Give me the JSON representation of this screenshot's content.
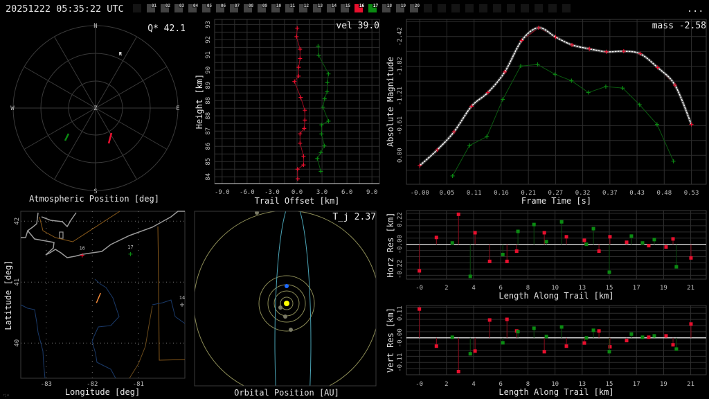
{
  "header": {
    "timestamp": "20251222 05:35:22 UTC",
    "menu_label": "...",
    "camera_boxes": [
      {
        "label": "",
        "state": "inactive"
      },
      {
        "label": "01",
        "state": "off"
      },
      {
        "label": "02",
        "state": "off"
      },
      {
        "label": "03",
        "state": "off"
      },
      {
        "label": "04",
        "state": "off"
      },
      {
        "label": "05",
        "state": "off"
      },
      {
        "label": "06",
        "state": "off"
      },
      {
        "label": "07",
        "state": "off"
      },
      {
        "label": "08",
        "state": "off"
      },
      {
        "label": "09",
        "state": "off"
      },
      {
        "label": "10",
        "state": "off"
      },
      {
        "label": "11",
        "state": "off"
      },
      {
        "label": "12",
        "state": "off"
      },
      {
        "label": "13",
        "state": "off"
      },
      {
        "label": "14",
        "state": "off"
      },
      {
        "label": "15",
        "state": "off"
      },
      {
        "label": "16",
        "state": "red"
      },
      {
        "label": "17",
        "state": "green"
      },
      {
        "label": "18",
        "state": "off"
      },
      {
        "label": "19",
        "state": "off"
      },
      {
        "label": "20",
        "state": "off"
      },
      {
        "label": "",
        "state": "inactive"
      },
      {
        "label": "",
        "state": "inactive"
      },
      {
        "label": "",
        "state": "inactive"
      },
      {
        "label": "",
        "state": "inactive"
      },
      {
        "label": "",
        "state": "inactive"
      },
      {
        "label": "",
        "state": "inactive"
      },
      {
        "label": "",
        "state": "inactive"
      },
      {
        "label": "",
        "state": "inactive"
      },
      {
        "label": "",
        "state": "inactive"
      },
      {
        "label": "",
        "state": "inactive"
      },
      {
        "label": "",
        "state": "inactive"
      }
    ]
  },
  "colors": {
    "red": "#e8102e",
    "green": "#0b8a12",
    "off": "#424242",
    "inactive": "#141414",
    "fit": "#ffffff",
    "trail": "#f28a3a",
    "orbit": "#8a8a55",
    "comet": "#4aa3b5",
    "earth": "#1f6bff",
    "sun": "#ffff00"
  },
  "atmospheric": {
    "title": "Atmospheric Position [deg]",
    "stat": "Q* 42.1",
    "labels": {
      "n": "N",
      "e": "E",
      "s": "S",
      "w": "W",
      "zenith": "Z",
      "radiant": "R"
    }
  },
  "map": {
    "xlabel": "Longitude [deg]",
    "ylabel": "Latitude [deg]",
    "x_ticks": [
      {
        "v": -83,
        "label": "-83"
      },
      {
        "v": -82,
        "label": "-82"
      },
      {
        "v": -81,
        "label": "-81"
      }
    ],
    "y_ticks": [
      {
        "v": 42,
        "label": "42"
      },
      {
        "v": 41,
        "label": "41"
      },
      {
        "v": 40,
        "label": "40"
      }
    ],
    "stations": [
      {
        "id": "16",
        "lon": -82.22,
        "lat": 41.44,
        "color": "red"
      },
      {
        "id": "17",
        "lon": -81.17,
        "lat": 41.46,
        "color": "green"
      },
      {
        "id": "14",
        "lon": -80.05,
        "lat": 40.63,
        "color": "off"
      }
    ],
    "trail": {
      "start": [
        -81.82,
        40.82
      ],
      "end": [
        -81.91,
        40.66
      ]
    },
    "watermark": "rjw"
  },
  "orbit": {
    "title": "Orbital Position [AU]",
    "stat": "T_j 2.37"
  },
  "chart_data": [
    {
      "type": "line",
      "id": "height",
      "title": "",
      "stat": "vel 39.0",
      "xlabel": "Trail Offset [km]",
      "ylabel": "Height [km]",
      "xlim": [
        -9.9,
        9.9
      ],
      "ylim": [
        83.6,
        93.3
      ],
      "x_ticks": [
        {
          "v": -9,
          "label": "-9.0"
        },
        {
          "v": -6,
          "label": "-6.0"
        },
        {
          "v": -3,
          "label": "-3.0"
        },
        {
          "v": 0,
          "label": "0.0"
        },
        {
          "v": 3,
          "label": "3.0"
        },
        {
          "v": 6,
          "label": "6.0"
        },
        {
          "v": 9,
          "label": "9.0"
        }
      ],
      "y_ticks": [
        {
          "v": 93.0,
          "label": "93"
        },
        {
          "v": 92.1,
          "label": "92"
        },
        {
          "v": 91.2,
          "label": "91"
        },
        {
          "v": 90.3,
          "label": "90"
        },
        {
          "v": 89.4,
          "label": "89"
        },
        {
          "v": 88.5,
          "label": "88"
        },
        {
          "v": 87.6,
          "label": "88"
        },
        {
          "v": 86.7,
          "label": "87"
        },
        {
          "v": 85.8,
          "label": "86"
        },
        {
          "v": 84.9,
          "label": "85"
        },
        {
          "v": 84.0,
          "label": "84"
        }
      ],
      "series": [
        {
          "name": "16",
          "color": "red",
          "x": [
            0.02,
            -0.06,
            0.36,
            0.36,
            0.19,
            0.19,
            -0.31,
            0.44,
            0.94,
            0.94,
            0.86,
            0.36,
            0.36,
            0.78,
            0.78,
            0.06,
            0.08
          ],
          "y": [
            92.78,
            92.28,
            91.54,
            90.99,
            90.47,
            89.95,
            89.63,
            88.69,
            87.93,
            87.35,
            86.86,
            86.54,
            85.99,
            85.22,
            84.7,
            84.45,
            83.88
          ]
        },
        {
          "name": "17",
          "color": "green",
          "x": [
            2.53,
            2.61,
            3.78,
            3.64,
            3.61,
            3.31,
            3.11,
            3.78,
            2.94,
            2.94,
            3.28,
            2.86,
            2.44,
            2.86
          ],
          "y": [
            91.72,
            91.17,
            90.08,
            89.57,
            89.03,
            88.61,
            88.11,
            87.29,
            87.07,
            86.53,
            85.83,
            85.43,
            85.08,
            84.32
          ]
        }
      ]
    },
    {
      "type": "line",
      "id": "magnitude",
      "stat": "mass -2.58",
      "xlabel": "Frame Time [s]",
      "ylabel": "Absolute Magnitude",
      "xlim": [
        -0.026,
        0.559
      ],
      "ylim": [
        0.59,
        -2.77
      ],
      "x_ticks": [
        {
          "v": 0,
          "label": "-0.00"
        },
        {
          "v": 0.053,
          "label": "0.05"
        },
        {
          "v": 0.106,
          "label": "0.11"
        },
        {
          "v": 0.159,
          "label": "0.16"
        },
        {
          "v": 0.212,
          "label": "0.21"
        },
        {
          "v": 0.265,
          "label": "0.27"
        },
        {
          "v": 0.318,
          "label": "0.32"
        },
        {
          "v": 0.371,
          "label": "0.37"
        },
        {
          "v": 0.424,
          "label": "0.43"
        },
        {
          "v": 0.477,
          "label": "0.48"
        },
        {
          "v": 0.53,
          "label": "0.53"
        }
      ],
      "y_ticks": [
        {
          "v": -2.42,
          "label": "-2.42"
        },
        {
          "v": -1.815,
          "label": "-1.82"
        },
        {
          "v": -1.21,
          "label": "-1.21"
        },
        {
          "v": -0.605,
          "label": "-0.61"
        },
        {
          "v": 0,
          "label": "0.00"
        }
      ],
      "series": [
        {
          "name": "16",
          "color": "red",
          "x": [
            0,
            0.034,
            0.067,
            0.101,
            0.133,
            0.166,
            0.199,
            0.232,
            0.265,
            0.297,
            0.331,
            0.364,
            0.398,
            0.43,
            0.464,
            0.498,
            0.53
          ],
          "y": [
            0.21,
            -0.11,
            -0.48,
            -1.0,
            -1.28,
            -1.7,
            -2.34,
            -2.6,
            -2.41,
            -2.25,
            -2.17,
            -2.11,
            -2.12,
            -2.07,
            -1.79,
            -1.43,
            -0.63
          ]
        },
        {
          "name": "17",
          "color": "green",
          "x": [
            0.064,
            0.097,
            0.131,
            0.162,
            0.197,
            0.23,
            0.264,
            0.296,
            0.329,
            0.363,
            0.396,
            0.429,
            0.463,
            0.495
          ],
          "y": [
            0.42,
            -0.2,
            -0.38,
            -1.14,
            -1.82,
            -1.85,
            -1.65,
            -1.52,
            -1.28,
            -1.4,
            -1.37,
            -1.03,
            -0.63,
            0.12
          ]
        }
      ],
      "fit_series": "16"
    },
    {
      "type": "scatter",
      "id": "horz",
      "xlabel": "Length Along Trail [km]",
      "ylabel": "Horz Res [km]",
      "xlim": [
        -1.0,
        22.2
      ],
      "ylim": [
        -0.31,
        0.3
      ],
      "x_ticks": [
        {
          "v": 0,
          "label": "-0"
        },
        {
          "v": 2.1,
          "label": "2"
        },
        {
          "v": 4.2,
          "label": "4"
        },
        {
          "v": 6.3,
          "label": "6"
        },
        {
          "v": 8.4,
          "label": "8"
        },
        {
          "v": 10.5,
          "label": "10"
        },
        {
          "v": 12.6,
          "label": "13"
        },
        {
          "v": 14.7,
          "label": "15"
        },
        {
          "v": 16.8,
          "label": "17"
        },
        {
          "v": 18.9,
          "label": "19"
        },
        {
          "v": 21.0,
          "label": "21"
        }
      ],
      "y_ticks": [
        {
          "v": 0.22,
          "label": "0.22"
        },
        {
          "v": 0,
          "label": "-0.00"
        },
        {
          "v": -0.22,
          "label": "-0.22"
        }
      ],
      "series": [
        {
          "name": "16",
          "color": "red",
          "x": [
            0,
            1.32,
            3.03,
            4.31,
            5.44,
            6.78,
            7.53,
            9.67,
            11.38,
            12.77,
            13.9,
            14.75,
            16.04,
            17.75,
            19.09,
            19.63,
            21.02
          ],
          "y": [
            -0.236,
            0.061,
            0.267,
            0.103,
            -0.152,
            -0.152,
            -0.061,
            0.103,
            0.067,
            0.036,
            -0.061,
            0.067,
            0.018,
            -0.012,
            -0.024,
            0.048,
            -0.121
          ]
        },
        {
          "name": "17",
          "color": "green",
          "x": [
            2.55,
            3.94,
            6.46,
            7.63,
            8.87,
            9.83,
            11.01,
            12.93,
            13.47,
            14.7,
            16.41,
            17.27,
            18.18,
            19.89
          ],
          "y": [
            0.012,
            -0.285,
            -0.091,
            0.115,
            0.176,
            0.024,
            0.2,
            0.0,
            0.139,
            -0.248,
            0.073,
            0.012,
            0.042,
            -0.2
          ]
        }
      ]
    },
    {
      "type": "scatter",
      "id": "vert",
      "xlabel": "Length Along Trail [km]",
      "ylabel": "Vert Res [km]",
      "xlim": [
        -1.0,
        22.2
      ],
      "ylim": [
        -0.165,
        0.145
      ],
      "x_ticks": [
        {
          "v": 0,
          "label": "-0"
        },
        {
          "v": 2.1,
          "label": "2"
        },
        {
          "v": 4.2,
          "label": "4"
        },
        {
          "v": 6.3,
          "label": "6"
        },
        {
          "v": 8.4,
          "label": "8"
        },
        {
          "v": 10.5,
          "label": "10"
        },
        {
          "v": 12.6,
          "label": "13"
        },
        {
          "v": 14.7,
          "label": "15"
        },
        {
          "v": 16.8,
          "label": "17"
        },
        {
          "v": 18.9,
          "label": "19"
        },
        {
          "v": 21.0,
          "label": "21"
        }
      ],
      "y_ticks": [
        {
          "v": 0.11,
          "label": "0.11"
        },
        {
          "v": 0,
          "label": "-0.00"
        },
        {
          "v": -0.11,
          "label": "-0.11"
        }
      ],
      "series": [
        {
          "name": "16",
          "color": "red",
          "x": [
            0,
            1.32,
            3.03,
            4.31,
            5.44,
            6.78,
            7.53,
            9.67,
            11.38,
            12.77,
            13.9,
            14.75,
            16.04,
            17.75,
            19.09,
            19.63,
            21.02
          ],
          "y": [
            0.129,
            -0.037,
            -0.151,
            -0.059,
            0.08,
            0.083,
            0.031,
            -0.062,
            -0.037,
            -0.023,
            0.031,
            -0.04,
            -0.012,
            0.003,
            0.009,
            -0.031,
            0.062
          ]
        },
        {
          "name": "17",
          "color": "green",
          "x": [
            2.55,
            3.94,
            6.46,
            7.63,
            8.87,
            9.83,
            11.01,
            12.93,
            13.47,
            14.7,
            16.41,
            17.27,
            18.18,
            19.89
          ],
          "y": [
            0.003,
            -0.071,
            -0.022,
            0.028,
            0.043,
            0.006,
            0.049,
            0.0,
            0.034,
            -0.062,
            0.017,
            0.003,
            0.009,
            -0.05
          ]
        }
      ]
    }
  ]
}
